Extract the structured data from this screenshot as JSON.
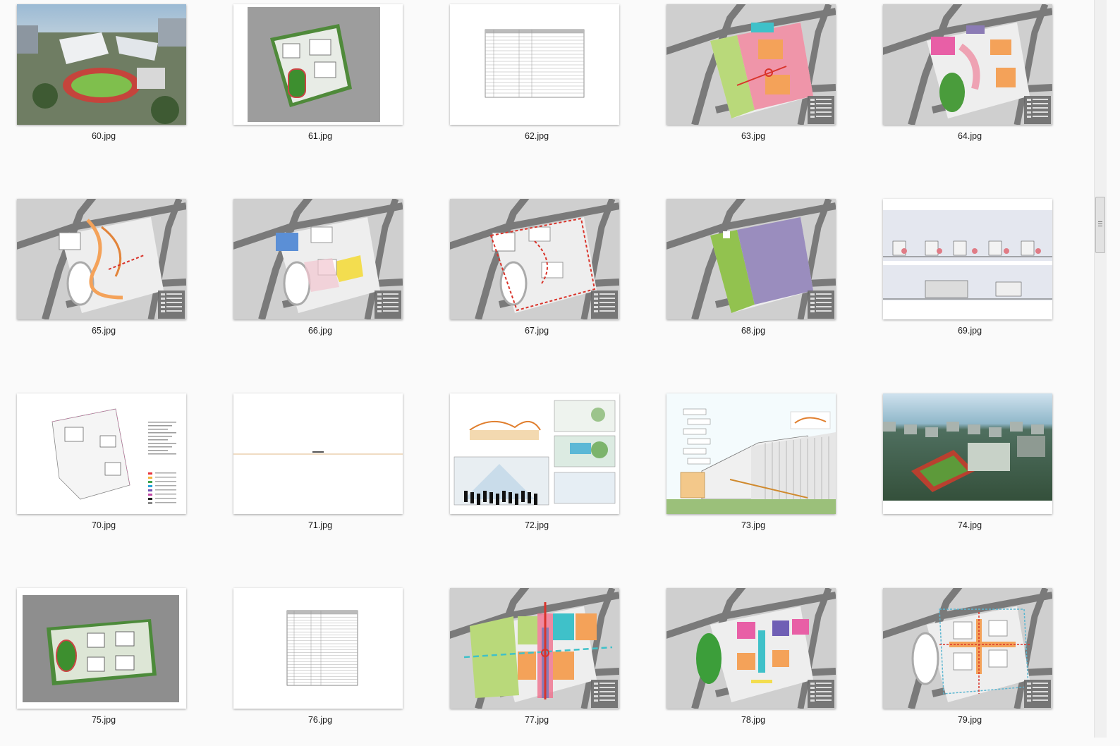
{
  "files": [
    {
      "name": "60.jpg",
      "kind": "aerial"
    },
    {
      "name": "61.jpg",
      "kind": "siteplan"
    },
    {
      "name": "62.jpg",
      "kind": "table"
    },
    {
      "name": "63.jpg",
      "kind": "zone-a"
    },
    {
      "name": "64.jpg",
      "kind": "zone-b"
    },
    {
      "name": "65.jpg",
      "kind": "circulation-a"
    },
    {
      "name": "66.jpg",
      "kind": "zone-c"
    },
    {
      "name": "67.jpg",
      "kind": "circulation-b"
    },
    {
      "name": "68.jpg",
      "kind": "zone-d"
    },
    {
      "name": "69.jpg",
      "kind": "elevation"
    },
    {
      "name": "70.jpg",
      "kind": "planning"
    },
    {
      "name": "71.jpg",
      "kind": "blank"
    },
    {
      "name": "72.jpg",
      "kind": "sketches"
    },
    {
      "name": "73.jpg",
      "kind": "section"
    },
    {
      "name": "74.jpg",
      "kind": "aerial-2"
    },
    {
      "name": "75.jpg",
      "kind": "siteplan-2"
    },
    {
      "name": "76.jpg",
      "kind": "table-2"
    },
    {
      "name": "77.jpg",
      "kind": "zone-e"
    },
    {
      "name": "78.jpg",
      "kind": "zone-f"
    },
    {
      "name": "79.jpg",
      "kind": "circulation-c"
    }
  ],
  "colors": {
    "paper": "#ffffff",
    "plan_gray": "#cfcfcf",
    "road": "#7a7a7a",
    "green": "#b9d97a",
    "orange": "#f4a259",
    "pink": "#ef6f8c",
    "purple": "#8b7bb5",
    "red_path": "#d9342b",
    "cyan": "#3fc1c9"
  }
}
